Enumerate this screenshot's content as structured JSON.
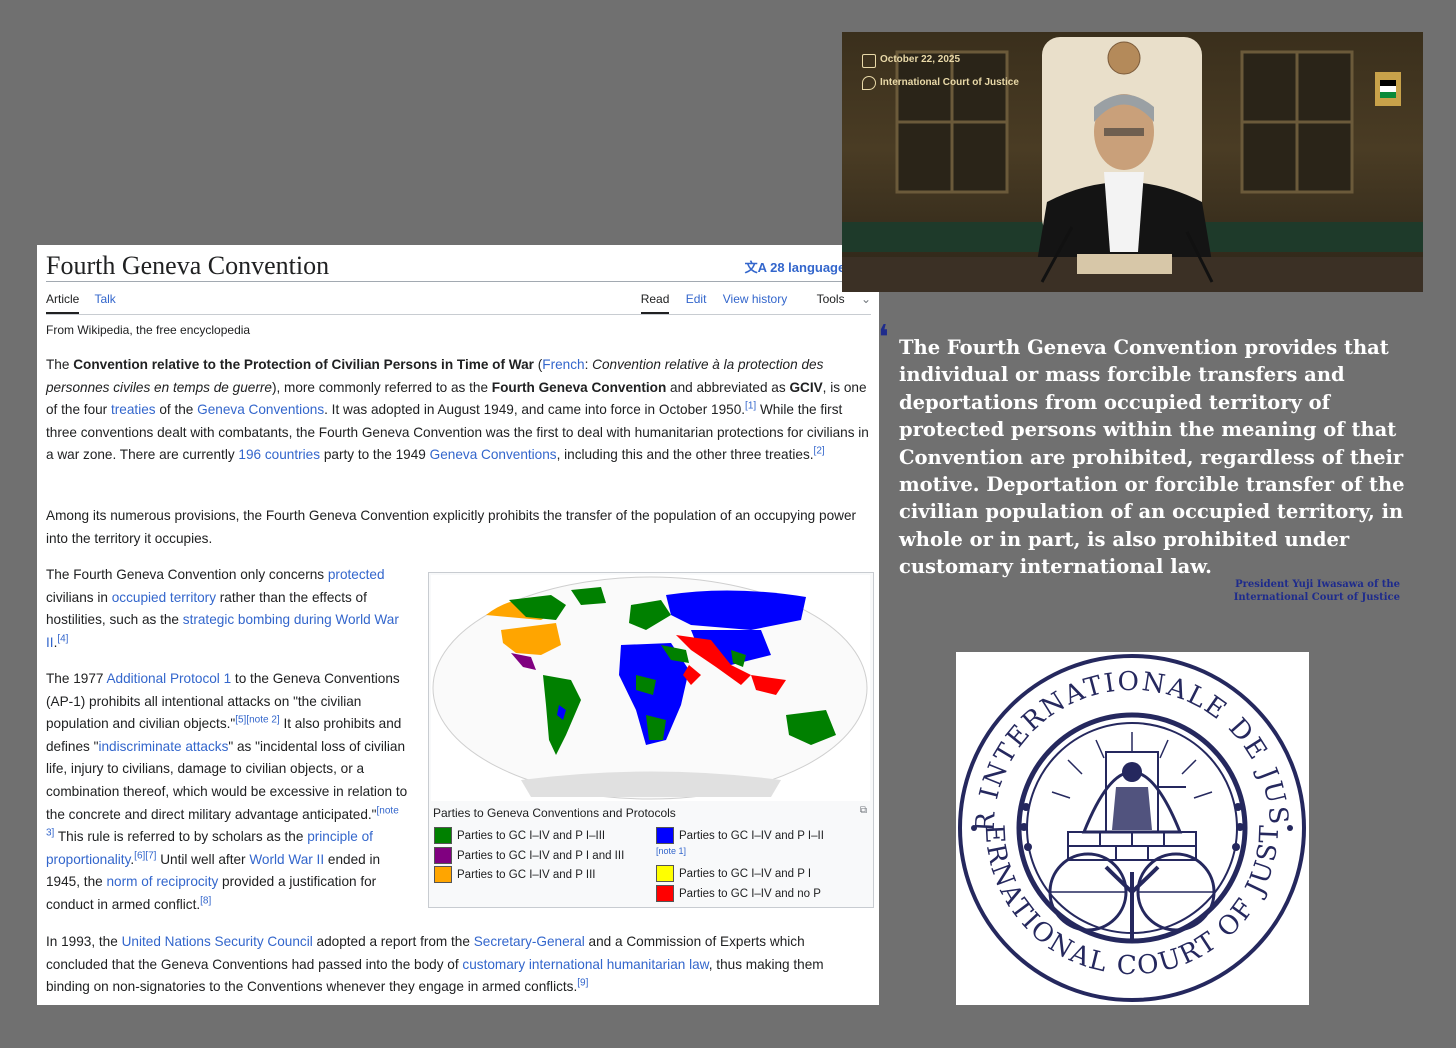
{
  "wiki": {
    "title": "Fourth Geneva Convention",
    "languages": "28 languages",
    "tabs_left": [
      "Article",
      "Talk"
    ],
    "tabs_right": [
      "Read",
      "Edit",
      "View history",
      "Tools"
    ],
    "tagline": "From Wikipedia, the free encyclopedia",
    "p1": {
      "a": "The ",
      "b": "Convention relative to the Protection of Civilian Persons in Time of War",
      "c": " (",
      "d": "French",
      "e": ": ",
      "f": "Convention relative à la protection des personnes civiles en temps de guerre",
      "g": "), more commonly referred to as the ",
      "h": "Fourth Geneva Convention",
      "i": " and abbreviated as ",
      "j": "GCIV",
      "k": ", is one of the four ",
      "l": "treaties",
      "m": " of the ",
      "n": "Geneva Conventions",
      "o": ". It was adopted in August 1949, and came into force in October 1950.",
      "r1": "[1]",
      "p": " While the first three conventions dealt with combatants, the Fourth Geneva Convention was the first to deal with humanitarian protections for civilians in a war zone. There are currently ",
      "q": "196 countries",
      "s": " party to the 1949 ",
      "t": "Geneva Conventions",
      "u": ", including this and the other three treaties.",
      "r2": "[2]"
    },
    "p2": "Among its numerous provisions, the Fourth Geneva Convention explicitly prohibits the transfer of the population of an occupying power into the territory it occupies.",
    "p3": {
      "a": "The Fourth Geneva Convention only concerns ",
      "b": "protected",
      "c": " civilians in ",
      "d": "occupied territory",
      "e": " rather than the effects of hostilities, such as the ",
      "f": "strategic bombing during World War II",
      "g": ".",
      "r": "[4]"
    },
    "p4": {
      "a": "The 1977 ",
      "b": "Additional Protocol 1",
      "c": " to the Geneva Conventions (AP-1) prohibits all intentional attacks on \"the civilian population and civilian objects.\"",
      "r1": "[5][note 2]",
      "d": " It also prohibits and defines \"",
      "e": "indiscriminate attacks",
      "f": "\" as \"incidental loss of civilian life, injury to civilians, damage to civilian objects, or a combination thereof, which would be excessive in relation to the concrete and direct military advantage anticipated.\"",
      "r2": "[note 3]",
      "g": " This rule is referred to by scholars as the ",
      "h": "principle of proportionality",
      "i": ".",
      "r3": "[6][7]",
      "j": " Until well after ",
      "k": "World War II",
      "l": " ended in 1945, the ",
      "m": "norm of reciprocity",
      "n": " provided a justification for conduct in armed conflict.",
      "r4": "[8]"
    },
    "p5": {
      "a": "In 1993, the ",
      "b": "United Nations Security Council",
      "c": " adopted a report from the ",
      "d": "Secretary-General",
      "e": " and a Commission of Experts which concluded that the Geneva Conventions had passed into the body of ",
      "f": "customary international humanitarian law",
      "g": ", thus making them binding on non-signatories to the Conventions whenever they engage in armed conflicts.",
      "r": "[9]"
    },
    "figure": {
      "caption": "Parties to Geneva Conventions and Protocols",
      "note": "[note 1]",
      "legend": [
        {
          "label": "Parties to GC I–IV and P I–III",
          "color": "#008000"
        },
        {
          "label": "Parties to GC I–IV and P I and III",
          "color": "#800080"
        },
        {
          "label": "Parties to GC I–IV and P III",
          "color": "#ffa500"
        },
        {
          "label": "Parties to GC I–IV and P I–II",
          "color": "#0000ff"
        },
        {
          "label": "Parties to GC I–IV and P I",
          "color": "#ffff00"
        },
        {
          "label": "Parties to GC I–IV and no P",
          "color": "#ff0000"
        }
      ]
    }
  },
  "video": {
    "date": "October 22, 2025",
    "location": "International Court of Justice"
  },
  "quote": {
    "text": "The Fourth Geneva Convention provides that individual or mass forcible transfers and deportations from occupied territory of protected persons within the meaning of that Convention are prohibited, regardless of their motive. Deportation or forcible transfer of the civilian population of an occupied territory, in whole or in part, is also prohibited under customary international law.",
    "attribution_line1": "President Yuji Iwasawa of the",
    "attribution_line2": "International Court of Justice"
  },
  "seal": {
    "text_top": "COUR INTERNATIONALE DE JUSTICE",
    "text_bottom": "INTERNATIONAL COURT OF JUSTICE"
  }
}
